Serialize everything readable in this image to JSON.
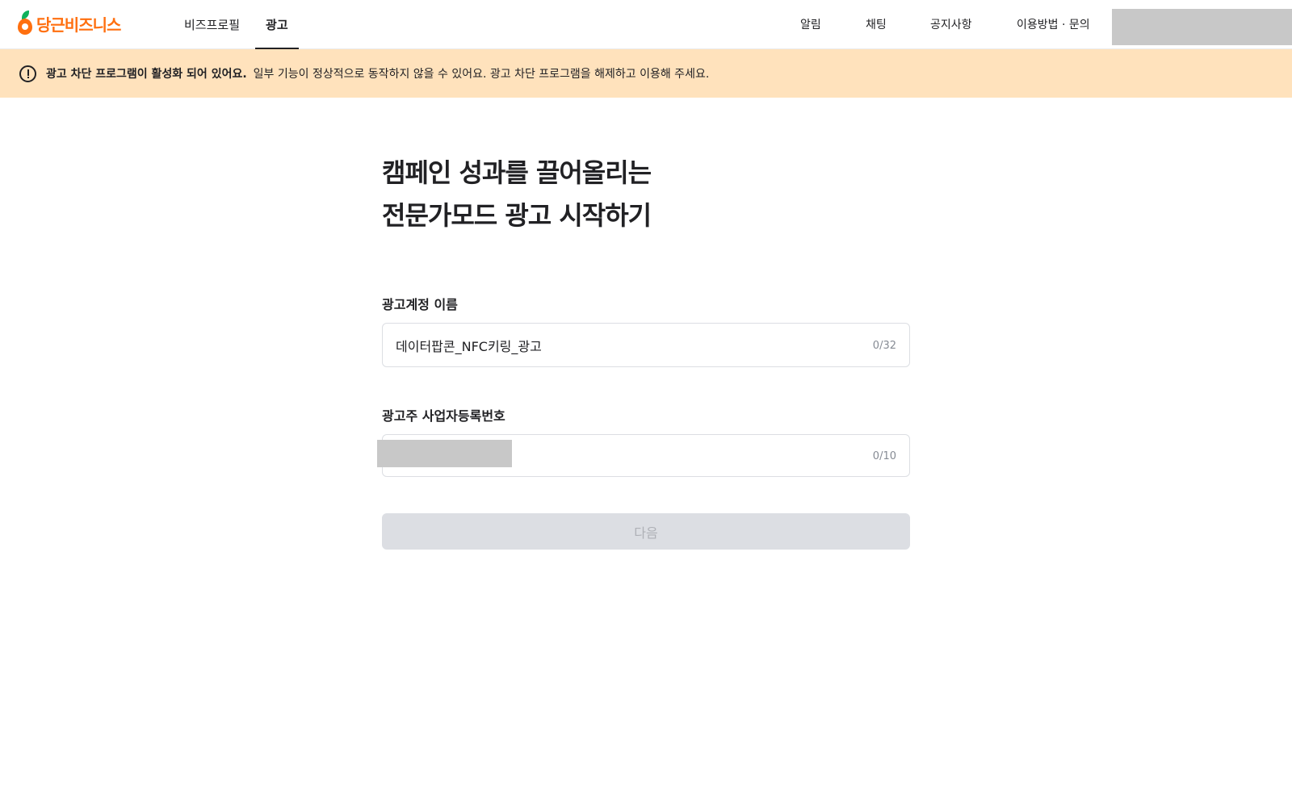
{
  "header": {
    "logo_text": "당근비즈니스",
    "nav_left": [
      {
        "label": "비즈프로필",
        "active": false
      },
      {
        "label": "광고",
        "active": true
      }
    ],
    "nav_right": [
      {
        "label": "알림"
      },
      {
        "label": "채팅"
      },
      {
        "label": "공지사항"
      },
      {
        "label": "이용방법 · 문의"
      }
    ]
  },
  "banner": {
    "bold_text": "광고 차단 프로그램이 활성화 되어 있어요.",
    "text": "일부 기능이 정상적으로 동작하지 않을 수 있어요. 광고 차단 프로그램을 해제하고 이용해 주세요.",
    "icon": "alert-circle-icon",
    "background": "#ffe2bc"
  },
  "main": {
    "headline_line1": "캠페인 성과를 끌어올리는",
    "headline_line2": "전문가모드 광고 시작하기",
    "account_name": {
      "label": "광고계정 이름",
      "value": "데이터팝콘_NFC키링_광고",
      "counter": "0/32"
    },
    "business_number": {
      "label": "광고주 사업자등록번호",
      "value": "",
      "counter": "0/10"
    },
    "next_button": "다음"
  },
  "colors": {
    "brand": "#ff6f0f",
    "disabled_button": "#dcdee3",
    "disabled_text": "#aeb0b6"
  }
}
